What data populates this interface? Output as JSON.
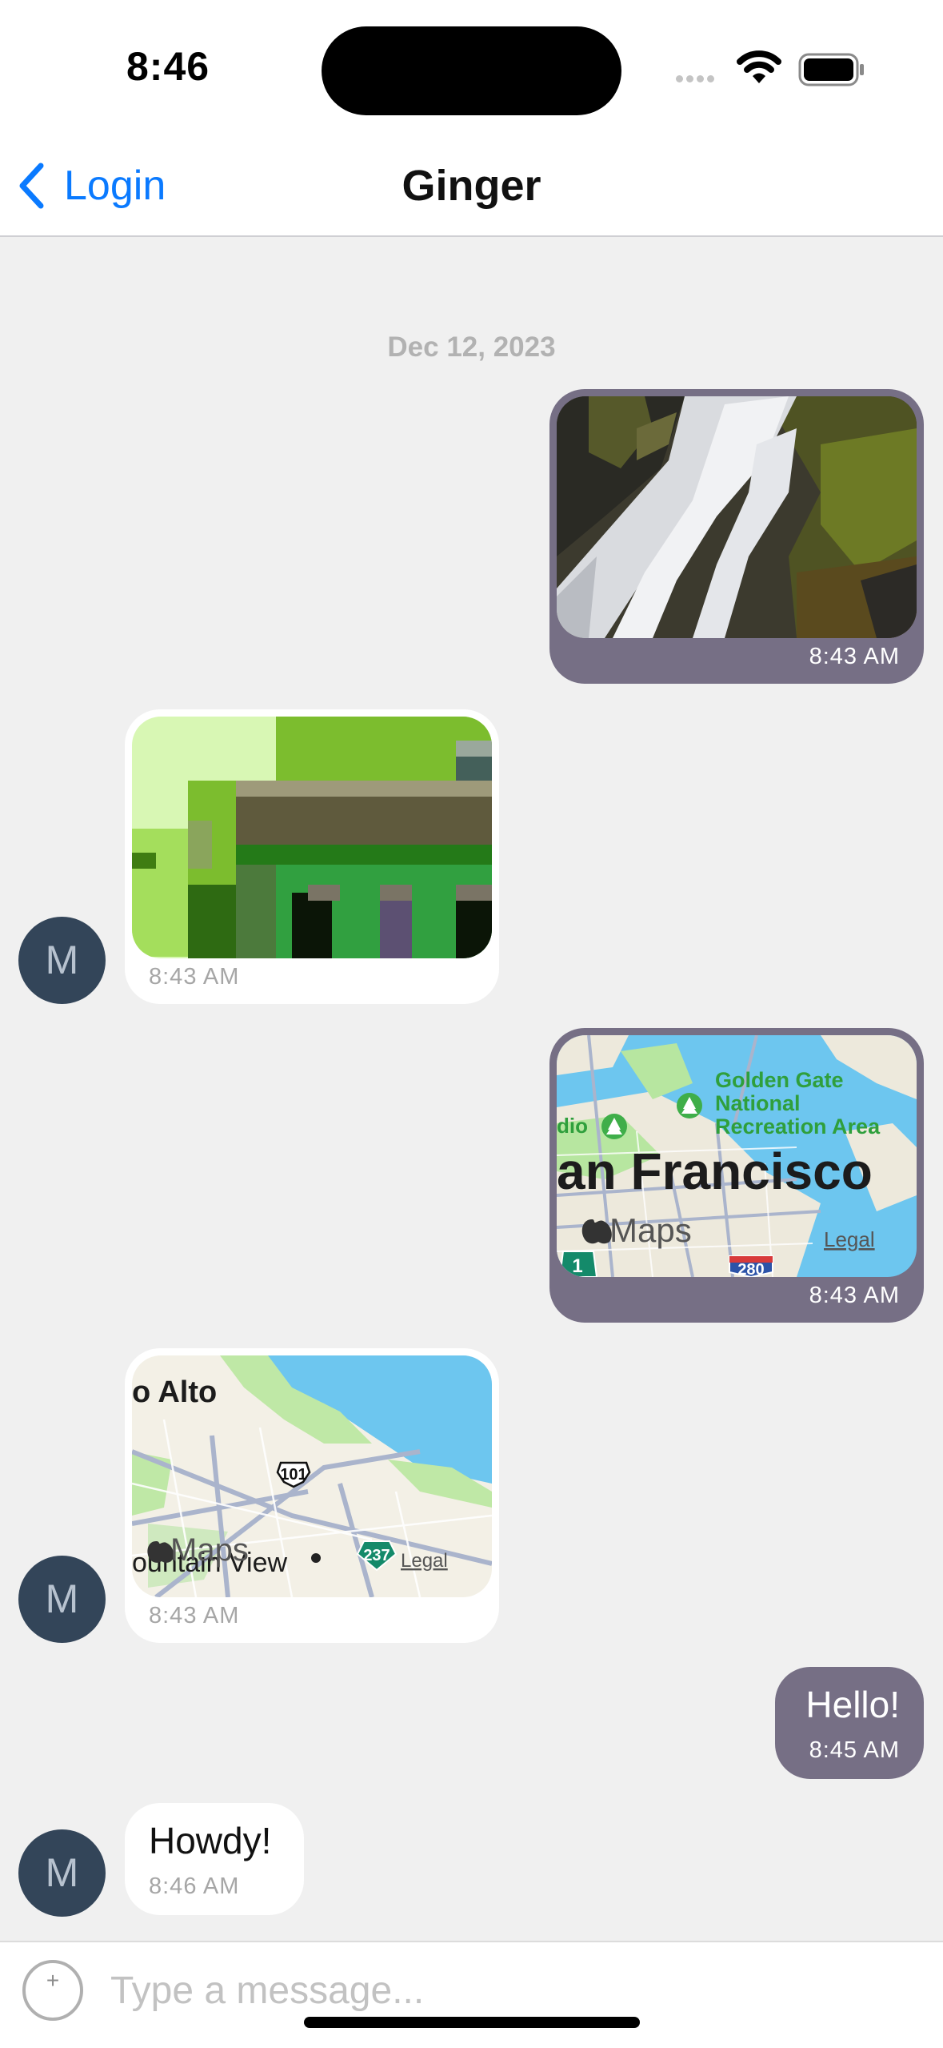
{
  "status_bar": {
    "time": "8:46"
  },
  "nav": {
    "back_label": "Login",
    "title": "Ginger"
  },
  "chat": {
    "date_header": "Dec 12, 2023",
    "messages": [
      {
        "direction": "outgoing",
        "type": "image",
        "content": "waterfall photo",
        "time": "8:43 AM"
      },
      {
        "direction": "incoming",
        "type": "image",
        "content": "pixel art",
        "time": "8:43 AM",
        "avatar": "M"
      },
      {
        "direction": "outgoing",
        "type": "map",
        "map_labels": [
          "Golden Gate",
          "National",
          "Recreation Area",
          "dio",
          "an Francisco",
          "Maps",
          "Legal",
          "1",
          "280"
        ],
        "time": "8:43 AM"
      },
      {
        "direction": "incoming",
        "type": "map",
        "map_labels": [
          "o Alto",
          "101",
          "Maps",
          "ountain View",
          "237",
          "Legal"
        ],
        "time": "8:43 AM",
        "avatar": "M"
      },
      {
        "direction": "outgoing",
        "type": "text",
        "text": "Hello!",
        "time": "8:45 AM"
      },
      {
        "direction": "incoming",
        "type": "text",
        "text": "Howdy!",
        "time": "8:46 AM",
        "avatar": "M"
      }
    ]
  },
  "composer": {
    "placeholder": "Type a message...",
    "attach_symbol": "+"
  },
  "colors": {
    "accent": "#0a7aff",
    "outgoing_bubble": "#766f85",
    "incoming_bubble": "#ffffff",
    "avatar": "#334559",
    "background": "#f0f0f0"
  }
}
